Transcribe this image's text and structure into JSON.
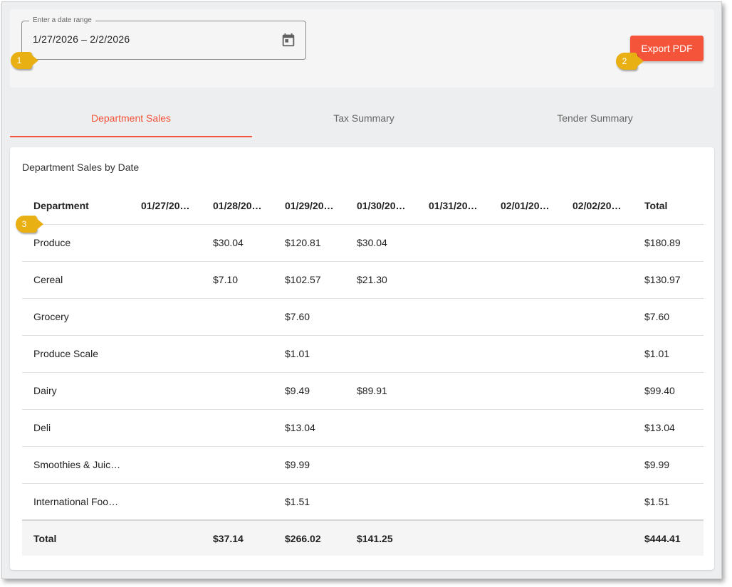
{
  "date_range": {
    "label": "Enter a date range",
    "value": "1/27/2026 – 2/2/2026",
    "icon": "calendar-icon"
  },
  "toolbar": {
    "export_label": "Export PDF"
  },
  "callouts": [
    "1",
    "2",
    "3"
  ],
  "tabs": [
    {
      "label": "Department Sales",
      "active": true
    },
    {
      "label": "Tax Summary",
      "active": false
    },
    {
      "label": "Tender Summary",
      "active": false
    }
  ],
  "report": {
    "title": "Department Sales by Date",
    "columns": [
      "Department",
      "01/27/20…",
      "01/28/20…",
      "01/29/20…",
      "01/30/20…",
      "01/31/20…",
      "02/01/20…",
      "02/02/20…",
      "Total"
    ],
    "rows": [
      [
        "Produce",
        "",
        "$30.04",
        "$120.81",
        "$30.04",
        "",
        "",
        "",
        "$180.89"
      ],
      [
        "Cereal",
        "",
        "$7.10",
        "$102.57",
        "$21.30",
        "",
        "",
        "",
        "$130.97"
      ],
      [
        "Grocery",
        "",
        "",
        "$7.60",
        "",
        "",
        "",
        "",
        "$7.60"
      ],
      [
        "Produce Scale",
        "",
        "",
        "$1.01",
        "",
        "",
        "",
        "",
        "$1.01"
      ],
      [
        "Dairy",
        "",
        "",
        "$9.49",
        "$89.91",
        "",
        "",
        "",
        "$99.40"
      ],
      [
        "Deli",
        "",
        "",
        "$13.04",
        "",
        "",
        "",
        "",
        "$13.04"
      ],
      [
        "Smoothies & Juic…",
        "",
        "",
        "$9.99",
        "",
        "",
        "",
        "",
        "$9.99"
      ],
      [
        "International Foo…",
        "",
        "",
        "$1.51",
        "",
        "",
        "",
        "",
        "$1.51"
      ]
    ],
    "totals": [
      "Total",
      "",
      "$37.14",
      "$266.02",
      "$141.25",
      "",
      "",
      "",
      "$444.41"
    ]
  },
  "colors": {
    "accent": "#f4543a",
    "callout": "#e8b013"
  }
}
